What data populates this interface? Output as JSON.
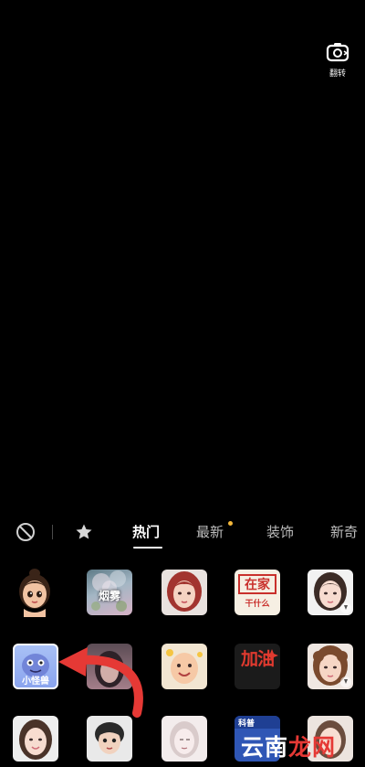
{
  "camera": {
    "flip_label": "翻转"
  },
  "tabs": {
    "items": [
      {
        "label": "热门",
        "active": true
      },
      {
        "label": "最新",
        "active": false,
        "has_new_dot": true
      },
      {
        "label": "装饰",
        "active": false
      },
      {
        "label": "新奇",
        "active": false
      }
    ]
  },
  "effects": {
    "row1": [
      {
        "name": "cartoon-girl",
        "caption": ""
      },
      {
        "name": "smoke",
        "caption": "烟雾"
      },
      {
        "name": "portrait-red-hair",
        "caption": ""
      },
      {
        "name": "at-home",
        "caption": "在家",
        "sub_caption": "干什么"
      },
      {
        "name": "portrait-girl",
        "caption": ""
      }
    ],
    "row2": [
      {
        "name": "little-monster",
        "caption": "小怪兽"
      },
      {
        "name": "blurred-girl",
        "caption": ""
      },
      {
        "name": "emoji-face",
        "caption": ""
      },
      {
        "name": "jiayou",
        "caption": "加油"
      },
      {
        "name": "portrait-curly",
        "caption": ""
      }
    ],
    "row3": [
      {
        "name": "portrait-smile",
        "caption": ""
      },
      {
        "name": "cartoon-boy",
        "caption": ""
      },
      {
        "name": "sketch-girl",
        "caption": ""
      },
      {
        "name": "science",
        "caption": "科普"
      },
      {
        "name": "portrait-light",
        "caption": ""
      }
    ]
  },
  "watermark": {
    "part1": "云南",
    "part2": "龙网"
  },
  "colors": {
    "accent_dot": "#f4b73a",
    "arrow": "#e53935"
  }
}
